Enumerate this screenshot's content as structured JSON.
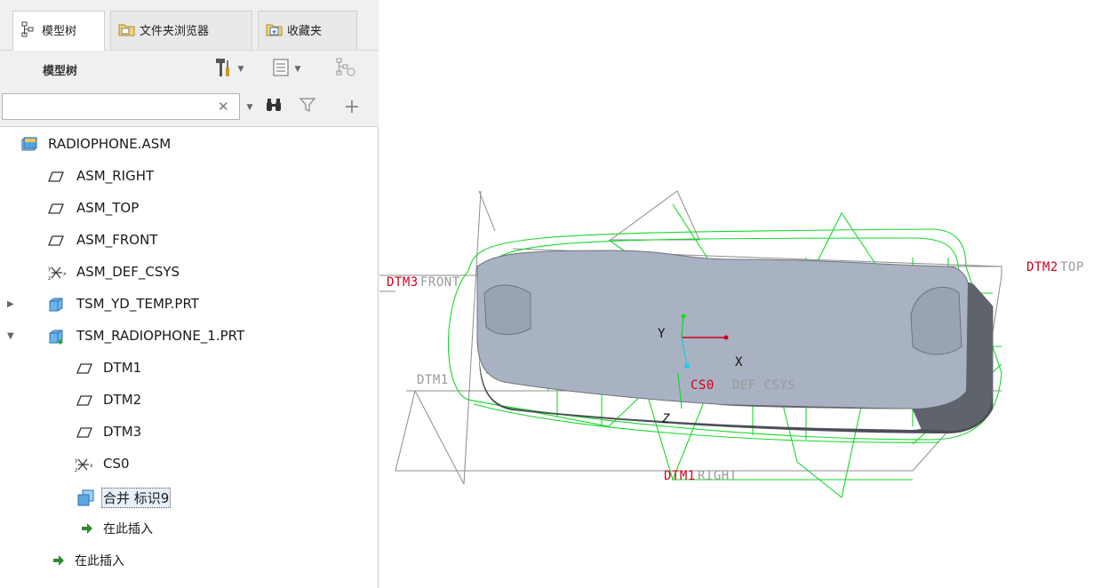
{
  "tabs": [
    {
      "label": "模型树",
      "icon": "tree-icon",
      "active": true
    },
    {
      "label": "文件夹浏览器",
      "icon": "folder-browser-icon",
      "active": false
    },
    {
      "label": "收藏夹",
      "icon": "favorites-icon",
      "active": false
    }
  ],
  "panel": {
    "title": "模型树",
    "search": {
      "value": "",
      "placeholder": ""
    }
  },
  "tree": [
    {
      "label": "RADIOPHONE.ASM",
      "icon": "assembly-icon"
    },
    {
      "label": "ASM_RIGHT",
      "icon": "datum-plane-icon"
    },
    {
      "label": "ASM_TOP",
      "icon": "datum-plane-icon"
    },
    {
      "label": "ASM_FRONT",
      "icon": "datum-plane-icon"
    },
    {
      "label": "ASM_DEF_CSYS",
      "icon": "coordinate-system-icon"
    },
    {
      "label": "TSM_YD_TEMP.PRT",
      "icon": "part-icon",
      "expanded": false
    },
    {
      "label": "TSM_RADIOPHONE_1.PRT",
      "icon": "part-active-icon",
      "expanded": true
    },
    {
      "label": "DTM1",
      "icon": "datum-plane-icon"
    },
    {
      "label": "DTM2",
      "icon": "datum-plane-icon"
    },
    {
      "label": "DTM3",
      "icon": "datum-plane-icon"
    },
    {
      "label": "CS0",
      "icon": "coordinate-system-icon"
    },
    {
      "label": "合并 标识9",
      "icon": "merge-icon",
      "selected": true
    },
    {
      "label": "在此插入",
      "icon": "insert-here-arrow-icon"
    },
    {
      "label": "在此插入",
      "icon": "insert-here-arrow-icon"
    }
  ],
  "viewport": {
    "labels": {
      "dtm3": "DTM3",
      "front": "FRONT",
      "dtm2": "DTM2",
      "top": "TOP",
      "dtm1_left": "DTM1",
      "dtm1": "DTM1",
      "right": "RIGHT",
      "cs0": "CS0",
      "def_csys": "_DEF_CSYS",
      "axis_x": "X",
      "axis_y": "Y",
      "axis_z": "Z"
    },
    "colors": {
      "datum_label": "#d2001a",
      "datum_name_gray": "#9a9a9a",
      "wireframe_green": "#18d82a",
      "plane_gray": "#8c8c8c",
      "body_top": "#a9b2c2",
      "body_side": "#5f636b"
    }
  }
}
